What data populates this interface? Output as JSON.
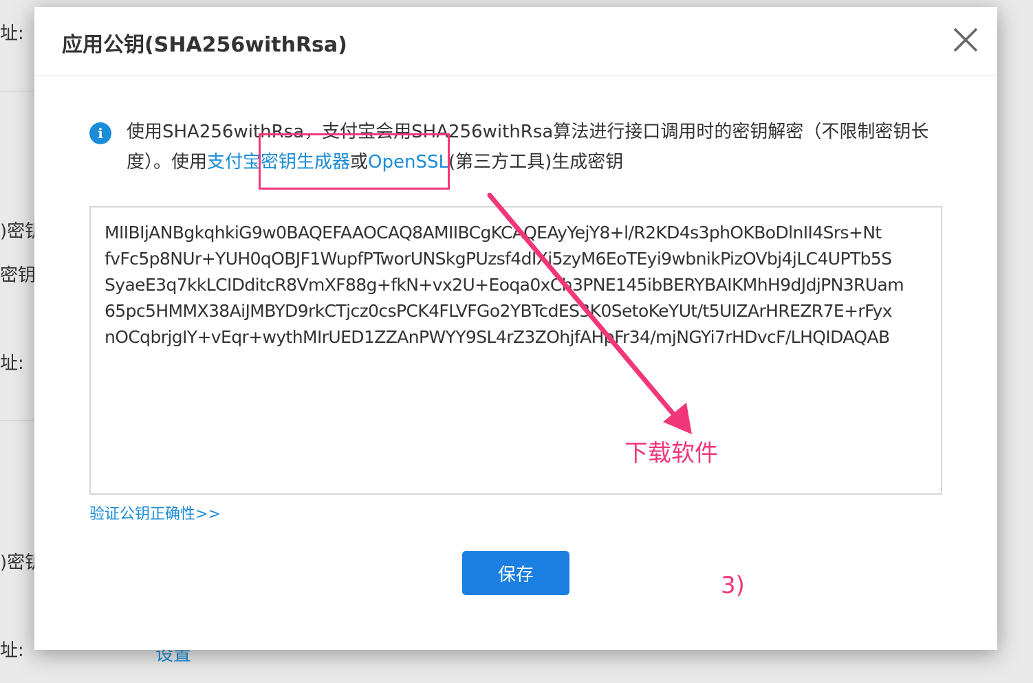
{
  "background": {
    "labels": [
      "址:",
      ")密钥",
      "密钥:",
      "址:",
      ")密钥",
      "址:"
    ],
    "link": "设置"
  },
  "modal": {
    "title": "应用公钥(SHA256withRsa)",
    "notice": {
      "text_before": "使用SHA256withRsa，支付宝会用SHA256withRsa算法进行接口调用时的密钥解密（不限制密钥长度）。使用",
      "link1": "支付宝密钥生成器",
      "text_middle": "或",
      "link2": "OpenSSL",
      "text_after": "(第三方工具)生成密钥"
    },
    "public_key_lines": [
      "MIIBIjANBgkqhkiG9w0BAQEFAAOCAQ8AMIIBCgKCAQEAyYejY8+l/R2KD4s3phOKBoDlnII4Srs+Nt",
      "fvFc5p8NUr+YUH0qOBJF1WupfPTworUNSkgPUzsf4dIXi5zyM6EoTEyi9wbnikPizOVbj4jLC4UPTb5S",
      "SyaeE3q7kkLCIDditcR8VmXF88g+fkN+vx2U+Eoqa0xCh3PNE145ibBERYBAIKMhH9dJdjPN3RUam",
      "65pc5HMMX38AiJMBYD9rkCTjcz0csPCK4FLVFGo2YBTcdES3K0SetoKeYUt/t5UIZArHREZR7E+rFyx",
      "nOCqbrjgIY+vEqr+wythMIrUED1ZZAnPWYY9SL4rZ3ZOhjfAHpFr34/mjNGYi7rHDvcF/LHQIDAQAB"
    ],
    "verify_link": "验证公钥正确性>>",
    "save_button": "保存"
  },
  "annotations": {
    "download_label": "下载软件",
    "step_label": "3)",
    "color": "#f2367a"
  },
  "colors": {
    "accent": "#1a8cd8",
    "button": "#1a7fe0"
  }
}
